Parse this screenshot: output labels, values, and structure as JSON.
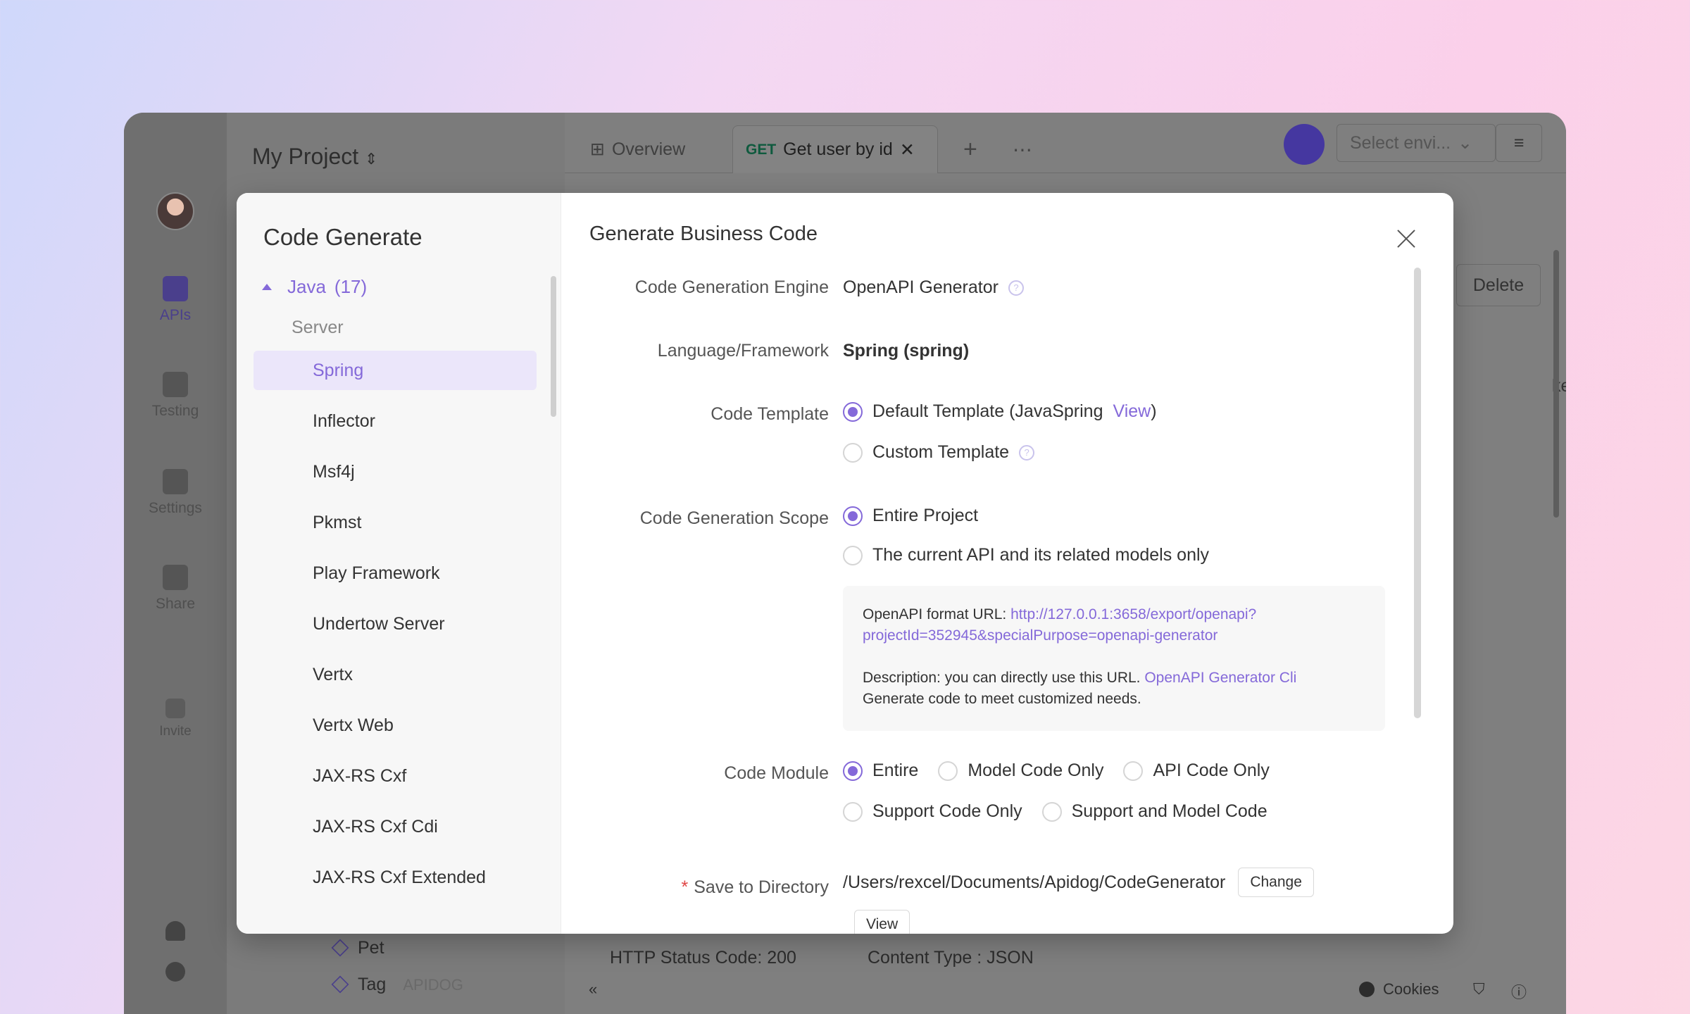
{
  "app": {
    "project_title": "My Project",
    "nav": [
      {
        "label": "APIs"
      },
      {
        "label": "Testing"
      },
      {
        "label": "Settings"
      },
      {
        "label": "Share"
      },
      {
        "label": "Invite"
      }
    ],
    "tabs": [
      {
        "label": "Overview"
      },
      {
        "method": "GET",
        "label": "Get user by id"
      }
    ],
    "env_placeholder": "Select envi...",
    "delete_label": "Delete",
    "partial_text": "keda",
    "tree_items": [
      "Pet",
      "Tag"
    ],
    "status_code": "HTTP Status Code: 200",
    "content_type": "Content Type : JSON",
    "cookies_label": "Cookies",
    "watermark": "APIDOG"
  },
  "modal": {
    "title": "Code Generate",
    "language": "Java",
    "language_count": "(17)",
    "group": "Server",
    "items": [
      "Spring",
      "Inflector",
      "Msf4j",
      "Pkmst",
      "Play Framework",
      "Undertow Server",
      "Vertx",
      "Vertx Web",
      "JAX-RS Cxf",
      "JAX-RS Cxf Cdi",
      "JAX-RS Cxf Extended"
    ],
    "active_item": "Spring",
    "panel_title": "Generate Business Code",
    "engine_label": "Code Generation Engine",
    "engine_value": "OpenAPI Generator",
    "framework_label": "Language/Framework",
    "framework_value": "Spring (spring)",
    "template_label": "Code Template",
    "template_default": "Default Template (JavaSpring",
    "template_view": "View",
    "template_close": ")",
    "template_custom": "Custom Template",
    "scope_label": "Code Generation Scope",
    "scope_entire": "Entire Project",
    "scope_current": "The current API and its related models only",
    "info_url_label": "OpenAPI format URL: ",
    "info_url_1": "http://127.0.0.1:3658/export/openapi?",
    "info_url_2": "projectId=352945&specialPurpose=openapi-generator",
    "info_desc": "Description: you can directly use this URL. ",
    "info_desc_link": "OpenAPI Generator Cli",
    "info_desc_2": "Generate code to meet customized needs.",
    "module_label": "Code Module",
    "module_options": [
      "Entire",
      "Model Code Only",
      "API Code Only",
      "Support Code Only",
      "Support and Model Code"
    ],
    "save_label": "Save to Directory",
    "save_path": "/Users/rexcel/Documents/Apidog/CodeGenerator",
    "change_button": "Change",
    "view_button": "View",
    "question_glyph": "?",
    "required_mark": "*"
  },
  "colors": {
    "accent": "#8469d9",
    "selected_bg": "#ebe6fa"
  }
}
